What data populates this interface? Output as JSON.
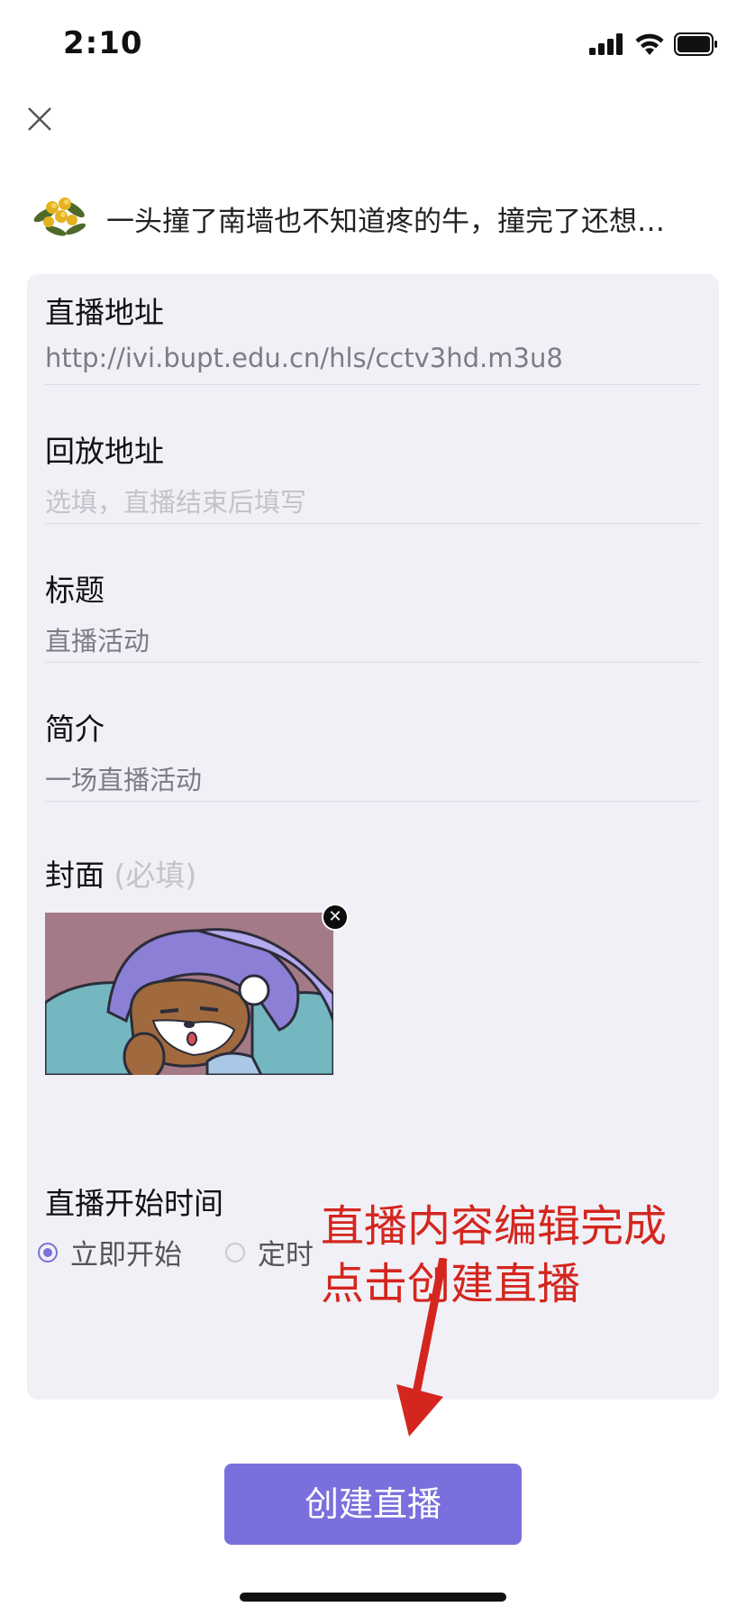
{
  "status_bar": {
    "time": "2:10"
  },
  "user": {
    "name": "一头撞了南墙也不知道疼的牛，撞完了还想…"
  },
  "form": {
    "live_url": {
      "label": "直播地址",
      "value": "http://ivi.bupt.edu.cn/hls/cctv3hd.m3u8"
    },
    "replay_url": {
      "label": "回放地址",
      "placeholder": "选填，直播结束后填写"
    },
    "title": {
      "label": "标题",
      "value": "直播活动"
    },
    "intro": {
      "label": "简介",
      "value": "一场直播活动"
    },
    "cover": {
      "label": "封面",
      "required_note": "(必填)"
    },
    "start_time": {
      "label": "直播开始时间",
      "options": [
        "立即开始",
        "定时"
      ],
      "selected": "立即开始"
    }
  },
  "annotation": {
    "line1": "直播内容编辑完成",
    "line2": "点击创建直播",
    "color": "#d4261e"
  },
  "create_button": {
    "label": "创建直播",
    "color": "#7a70dd"
  }
}
